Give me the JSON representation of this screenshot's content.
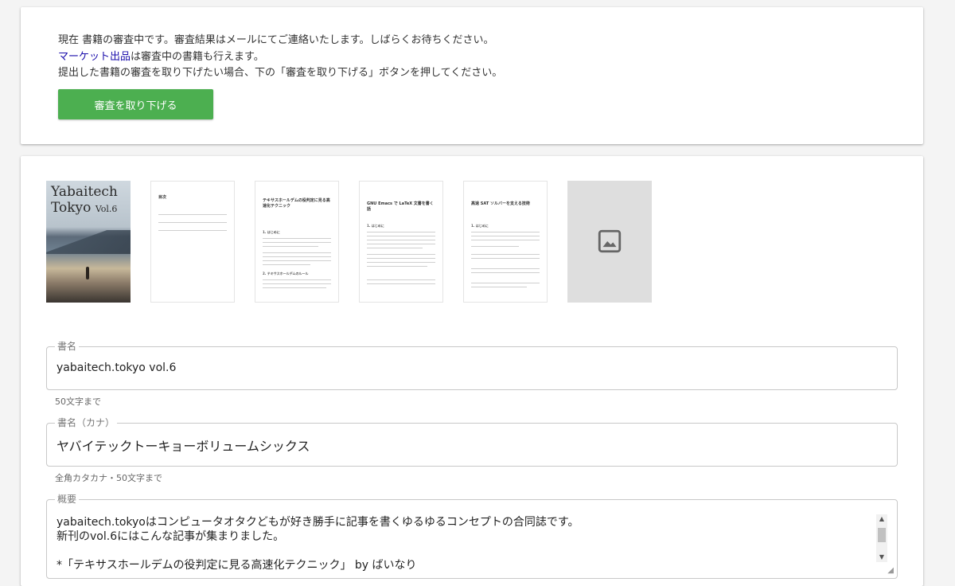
{
  "status": {
    "line1": "現在 書籍の審査中です。審査結果はメールにてご連絡いたします。しばらくお待ちください。",
    "market_link": "マーケット出品",
    "line2_rest": "は審査中の書籍も行えます。",
    "line3": "提出した書籍の審査を取り下げたい場合、下の「審査を取り下げる」ボタンを押してください。",
    "withdraw_button": "審査を取り下げる",
    "accent_color": "#4caf50"
  },
  "thumbnails": {
    "cover": {
      "title_line1": "Yabaitech",
      "title_line2": "Tokyo",
      "vol": "Vol.6"
    },
    "pages": [
      {
        "title": "目次",
        "icon": "toc-page"
      },
      {
        "title": "テキサスホールデムの役判定に見る高速化テクニック",
        "icon": "document-page"
      },
      {
        "title": "GNU Emacs で LaTeX 文書を書く話",
        "icon": "document-page"
      },
      {
        "title": "高速 SAT ソルバーを支える技術",
        "icon": "document-page"
      }
    ],
    "placeholder_icon": "image-icon"
  },
  "form": {
    "title": {
      "label": "書名",
      "value": "yabaitech.tokyo vol.6",
      "helper": "50文字まで"
    },
    "title_kana": {
      "label": "書名（カナ）",
      "value": "ヤバイテックトーキョーボリュームシックス",
      "helper": "全角カタカナ・50文字まで"
    },
    "summary": {
      "label": "概要",
      "value": "yabaitech.tokyoはコンピュータオタクどもが好き勝手に記事を書くゆるゆるコンセプトの合同誌です。\n新刊のvol.6にはこんな記事が集まりました。\n\n*「テキサスホールデムの役判定に見る高速化テクニック」 by ばいなり"
    }
  }
}
